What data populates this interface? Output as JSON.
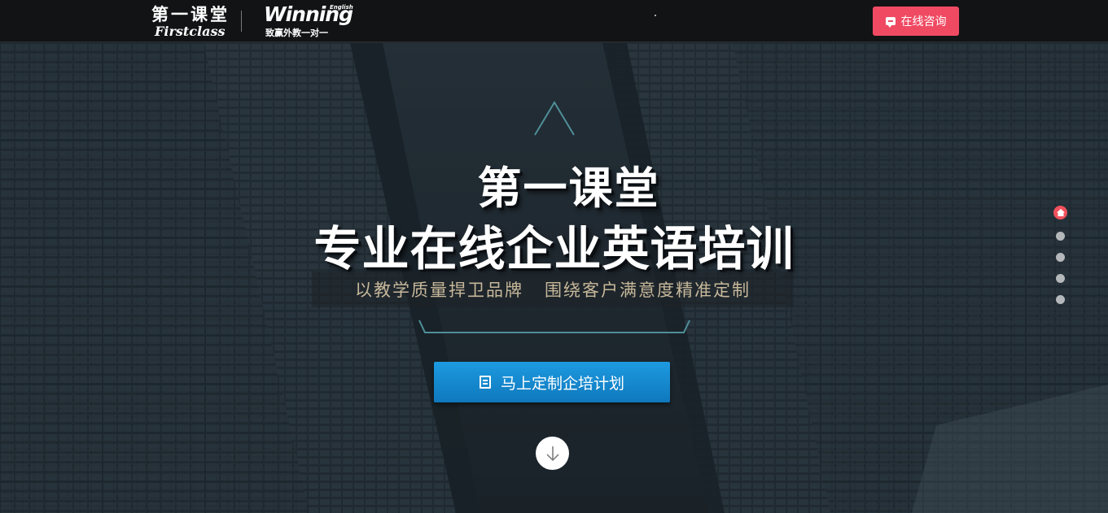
{
  "header": {
    "logo_cn": "第一课堂",
    "logo_en": "Firstclass",
    "partner_logo_word": "Winning",
    "partner_logo_sup": "English",
    "partner_logo_sub": "致赢外教一对一",
    "consult_button": "在线咨询"
  },
  "hero": {
    "title_line1": "第一课堂",
    "title_line2": "专业在线企业英语培训",
    "subtitle_part1": "以教学质量捍卫品牌",
    "subtitle_part2": "围绕客户满意度精准定制",
    "cta_button": "马上定制企培计划"
  },
  "dot_nav": {
    "count": 5,
    "active_index": 0
  },
  "colors": {
    "topbar_bg": "#121314",
    "consult_accent": "#f04a63",
    "cta_blue": "#1d9ae0",
    "subtitle_gold": "#c7b89a",
    "dot_active": "#f0515d",
    "dot_inactive": "#b5b8bb"
  },
  "icons": {
    "consult": "chat-bubble-icon",
    "cta": "document-icon",
    "scroll": "arrow-down-icon",
    "nav_home": "home-icon"
  }
}
